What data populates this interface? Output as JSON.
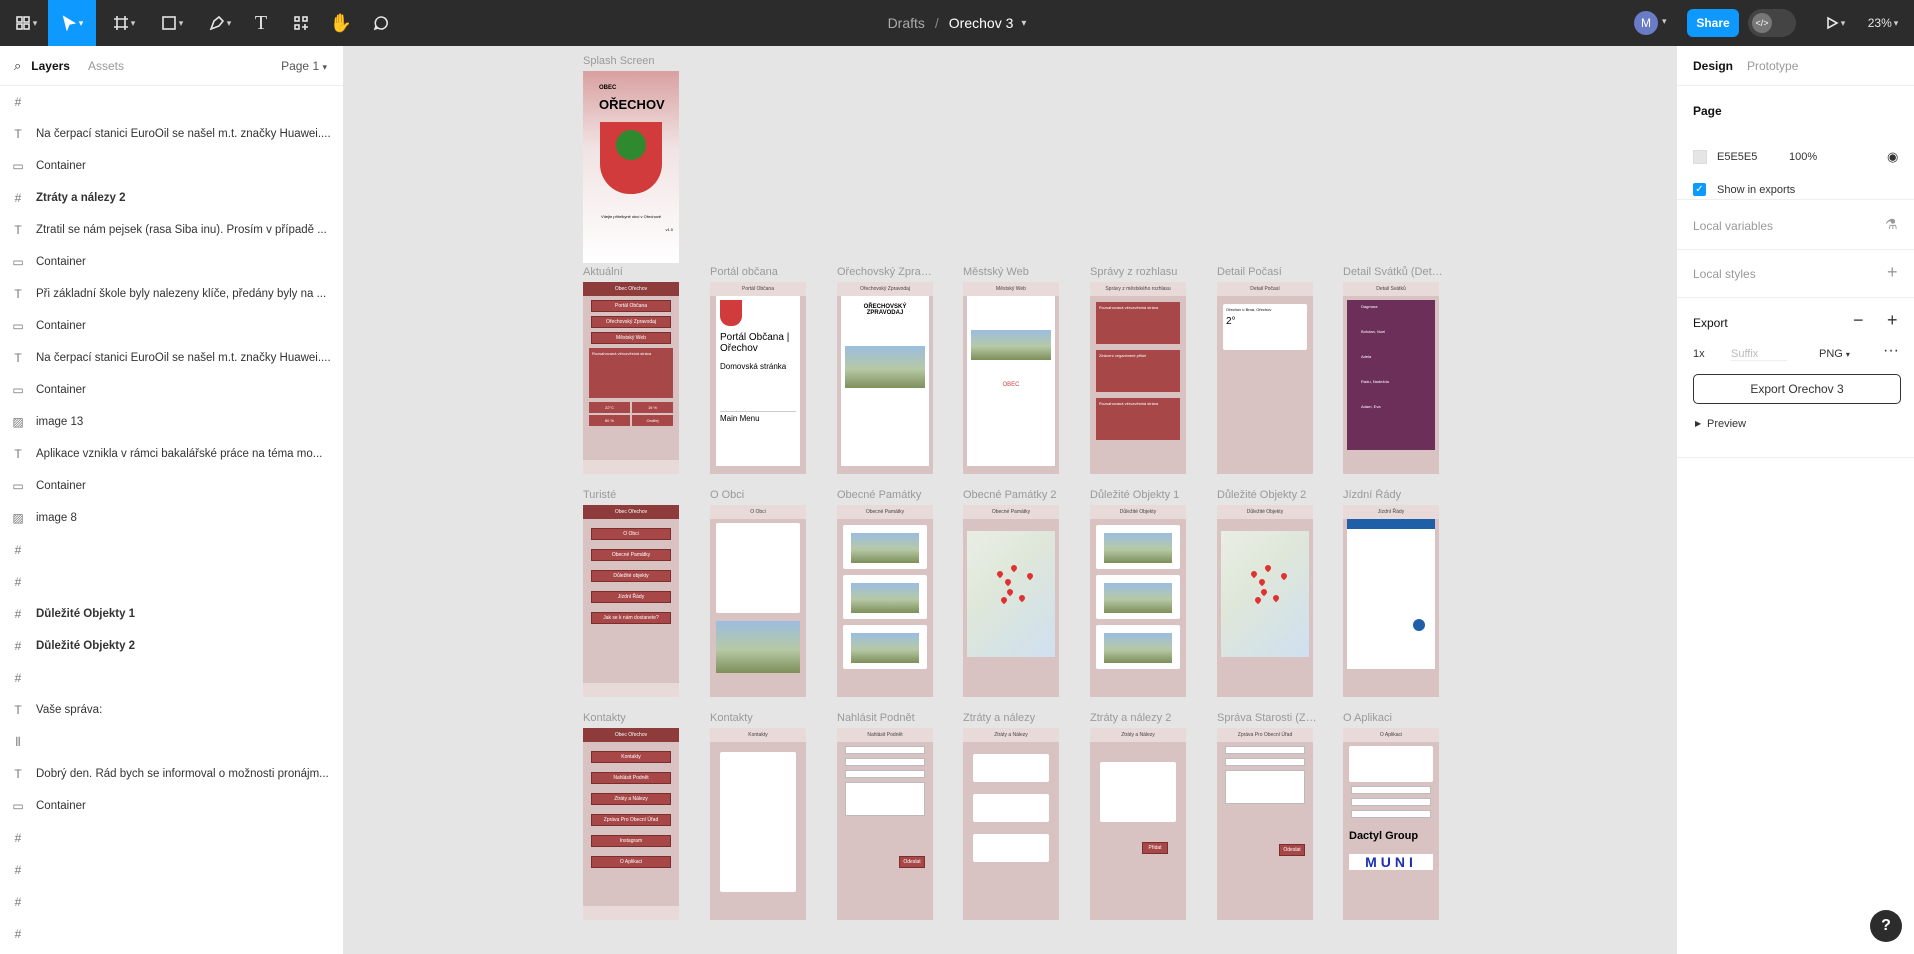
{
  "toolbar": {
    "breadcrumb_project": "Drafts",
    "breadcrumb_sep": "/",
    "file_name": "Orechov 3",
    "avatar_initial": "M",
    "share_label": "Share",
    "zoom": "23%",
    "icons": [
      "figma-menu-icon",
      "move-icon",
      "frame-icon",
      "rectangle-icon",
      "pen-icon",
      "text-icon",
      "resources-icon",
      "hand-icon",
      "comment-icon",
      "present-icon"
    ]
  },
  "left": {
    "tab_layers": "Layers",
    "tab_assets": "Assets",
    "page_select": "Page 1",
    "layers": [
      {
        "type": "frame",
        "label": "",
        "bold": false
      },
      {
        "type": "text",
        "label": "Na čerpací stanici EuroOil se našel m.t. značky Huawei....",
        "bold": false
      },
      {
        "type": "rect",
        "label": "Container",
        "bold": false
      },
      {
        "type": "frame",
        "label": "Ztráty a nálezy 2",
        "bold": true
      },
      {
        "type": "text",
        "label": "Ztratil se nám pejsek (rasa Šiba inu). Prosím v případě ...",
        "bold": false
      },
      {
        "type": "rect",
        "label": "Container",
        "bold": false
      },
      {
        "type": "text",
        "label": "Při základní škole byly nalezeny klíče, předány byly na ...",
        "bold": false
      },
      {
        "type": "rect",
        "label": "Container",
        "bold": false
      },
      {
        "type": "text",
        "label": "Na čerpací stanici EuroOil se našel m.t. značky Huawei....",
        "bold": false
      },
      {
        "type": "rect",
        "label": "Container",
        "bold": false
      },
      {
        "type": "image",
        "label": "image 13",
        "bold": false
      },
      {
        "type": "text",
        "label": "Aplikace vznikla v rámci bakalářské práce na téma mo...",
        "bold": false
      },
      {
        "type": "rect",
        "label": "Container",
        "bold": false
      },
      {
        "type": "image",
        "label": "image 8",
        "bold": false
      },
      {
        "type": "frame",
        "label": "",
        "bold": false
      },
      {
        "type": "frame",
        "label": "",
        "bold": false
      },
      {
        "type": "frame",
        "label": "Důležité Objekty 1",
        "bold": true
      },
      {
        "type": "frame",
        "label": "Důležité Objekty 2",
        "bold": true
      },
      {
        "type": "frame",
        "label": "",
        "bold": false
      },
      {
        "type": "text",
        "label": "Vaše správa:",
        "bold": false
      },
      {
        "type": "layout",
        "label": "",
        "bold": false
      },
      {
        "type": "text",
        "label": "Dobrý den. Rád bych se informoval o možnosti pronájm...",
        "bold": false
      },
      {
        "type": "rect",
        "label": "Container",
        "bold": false
      },
      {
        "type": "frame",
        "label": "",
        "bold": false
      },
      {
        "type": "frame",
        "label": "",
        "bold": false
      },
      {
        "type": "frame",
        "label": "",
        "bold": false
      },
      {
        "type": "frame",
        "label": "",
        "bold": false
      }
    ]
  },
  "right": {
    "tab_design": "Design",
    "tab_prototype": "Prototype",
    "page_title": "Page",
    "page_color": "E5E5E5",
    "page_color_hex": "#E5E5E5",
    "page_opacity": "100%",
    "show_in_exports": "Show in exports",
    "local_variables": "Local variables",
    "local_styles": "Local styles",
    "export_title": "Export",
    "export_scale": "1x",
    "export_suffix_placeholder": "Suffix",
    "export_format": "PNG",
    "export_button": "Export Orechov 3",
    "preview": "Preview"
  },
  "canvas": {
    "splash": {
      "label": "Splash Screen",
      "obec": "OBEC",
      "name": "OŘECHOV",
      "tagline": "Vítejte přítelkyně obcí v Ořechově",
      "version": "v1.0"
    },
    "row1": [
      {
        "label": "Aktuální",
        "kind": "menu",
        "header": "Obec Ořechov",
        "buttons": [
          "Portál Občana",
          "Ořechovský Zpravodaj",
          "Městský Web"
        ],
        "news_title": "Rozsahovaná věrozvěstná stráva",
        "w_temp": "22°C",
        "w_hum": "19 %",
        "w_rain": "60 %",
        "w_name": "Ondřej"
      },
      {
        "label": "Portál občana",
        "kind": "portal",
        "header": "Portál Občana",
        "big_text": "Portál Občana | Ořechov",
        "sub_text": "Domovská stránka",
        "menu_text": "Main Menu"
      },
      {
        "label": "Ořechovský Zpravodaj",
        "kind": "zpravodaj",
        "header": "Ořechovský Zpravodaj",
        "mast": "OŘECHOVSKÝ ZPRAVODAJ"
      },
      {
        "label": "Městský Web",
        "kind": "web",
        "header": "Městský Web",
        "obec": "OBEC"
      },
      {
        "label": "Správy z rozhlasu",
        "kind": "news",
        "header": "Správy z městského rozhlasu",
        "items": [
          "Rozsahovaná věrozvěstná stráva",
          "Ztrácení veganiment přišel",
          "Rozsahovaná věrozvěstná stráva"
        ]
      },
      {
        "label": "Detail Počasí",
        "kind": "weather",
        "header": "Detail Počasí",
        "city": "Ořechov u Brna, Ořechov",
        "temp": "2°"
      },
      {
        "label": "Detail Svátků (Detail Svátků)",
        "kind": "holidays",
        "header": "Detail Svátků",
        "names": [
          "Dagmara",
          "Bohdan, Noel",
          "Adela",
          "Radu, Nadežda",
          "Adam, Eva"
        ]
      }
    ],
    "row2": [
      {
        "label": "Turisté",
        "kind": "menu2",
        "header": "Obec Ořechov",
        "buttons": [
          "O Obci",
          "Obecné Památky",
          "Důležité objekty",
          "Jízdní Řády",
          "Jak se k nám dostanete?"
        ]
      },
      {
        "label": "O Obci",
        "kind": "about",
        "header": "O Obci"
      },
      {
        "label": "Obecné Památky",
        "kind": "monuments",
        "header": "Obecné Památky"
      },
      {
        "label": "Obecné Památky 2",
        "kind": "map",
        "header": "Obecné Památky"
      },
      {
        "label": "Důležité Objekty 1",
        "kind": "monuments",
        "header": "Důležité Objekty"
      },
      {
        "label": "Důležité Objekty 2",
        "kind": "map",
        "header": "Důležité Objekty"
      },
      {
        "label": "Jízdní Řády",
        "kind": "transit",
        "header": "Jízdní Řády"
      }
    ],
    "row3": [
      {
        "label": "Kontakty",
        "kind": "menu3",
        "header": "Obec Ořechov",
        "buttons": [
          "Kontakty",
          "Nahlásit Podnět",
          "Ztráty a Nálezy",
          "Zpráva Pro Obecní Úřad",
          "Instagram",
          "O Aplikaci"
        ]
      },
      {
        "label": "Kontakty",
        "kind": "contacts",
        "header": "Kontakty"
      },
      {
        "label": "Nahlásit Podnět",
        "kind": "report",
        "header": "Nahlásit Podnět",
        "submit": "Odeslat"
      },
      {
        "label": "Ztráty a nálezy",
        "kind": "lost",
        "header": "Ztráty a Nálezy"
      },
      {
        "label": "Ztráty a nálezy 2",
        "kind": "lost2",
        "header": "Ztráty a Nálezy",
        "submit": "Přidat"
      },
      {
        "label": "Správa Starosti (Zpráva Pro Obecní Úřad)",
        "kind": "report2",
        "header": "Zpráva Pro Obecní Úřad",
        "submit": "Odeslat"
      },
      {
        "label": "O Aplikaci",
        "kind": "app",
        "header": "O Aplikaci",
        "brand1": "Dactyl Group",
        "brand2": "MUNI"
      }
    ]
  },
  "help": "?"
}
